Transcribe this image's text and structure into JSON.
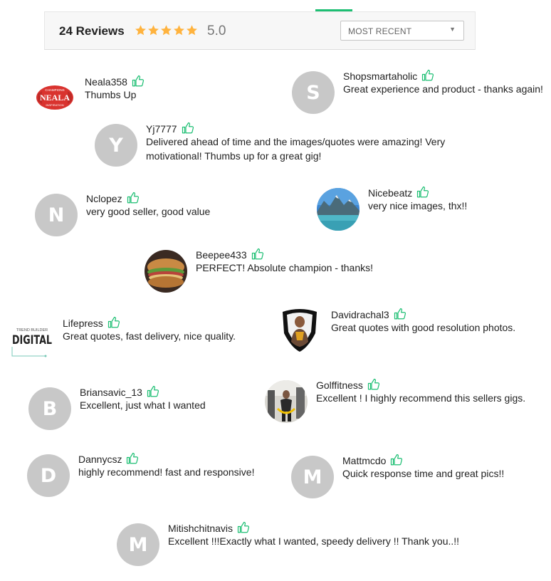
{
  "header": {
    "review_count": "24 Reviews",
    "rating": "5.0",
    "star_count": 5,
    "star_color": "#ffb33e",
    "accent_color": "#1dbf73",
    "sort_label": "MOST RECENT",
    "sort_arrow_icon": "caret-down-icon"
  },
  "neala_logo": {
    "top_text": "CHAMPIONS",
    "main_text": "NEALA",
    "bottom_text": "INSPIRATION"
  },
  "lifepress_logo": {
    "top_text": "TREND BUILDER",
    "main_text": "DIGITAL"
  },
  "reviews": [
    {
      "username": "Neala358",
      "text": "Thumbs Up",
      "avatar_type": "logo"
    },
    {
      "username": "Shopsmartaholic",
      "text": "Great experience and product - thanks again!",
      "avatar_letter": "S"
    },
    {
      "username": "Yj7777",
      "text": "Delivered ahead of time and the images/quotes were amazing! Very motivational! Thumbs up for a great gig!",
      "avatar_letter": "Y"
    },
    {
      "username": "Nclopez",
      "text": "very good seller, good value",
      "avatar_letter": "N"
    },
    {
      "username": "Nicebeatz",
      "text": "very nice images, thx!!",
      "avatar_type": "photo-lake"
    },
    {
      "username": "Beepee433",
      "text": "PERFECT! Absolute champion - thanks!",
      "avatar_type": "photo-sandwich"
    },
    {
      "username": "Lifepress",
      "text": "Great quotes, fast delivery, nice quality.",
      "avatar_type": "logo"
    },
    {
      "username": "Davidrachal3",
      "text": "Great quotes with good resolution photos.",
      "avatar_type": "photo-person"
    },
    {
      "username": "Briansavic_13",
      "text": "Excellent, just what I wanted",
      "avatar_letter": "B"
    },
    {
      "username": "Golffitness",
      "text": "Excellent ! I highly recommend this sellers gigs.",
      "avatar_type": "photo-gym"
    },
    {
      "username": "Dannycsz",
      "text": "highly recommend! fast and responsive!",
      "avatar_letter": "D"
    },
    {
      "username": "Mattmcdo",
      "text": "Quick response time and great pics!!",
      "avatar_letter": "M"
    },
    {
      "username": "Mitishchitnavis",
      "text": "Excellent !!!Exactly what I wanted, speedy delivery !! Thank you..!!",
      "avatar_letter": "M"
    }
  ]
}
